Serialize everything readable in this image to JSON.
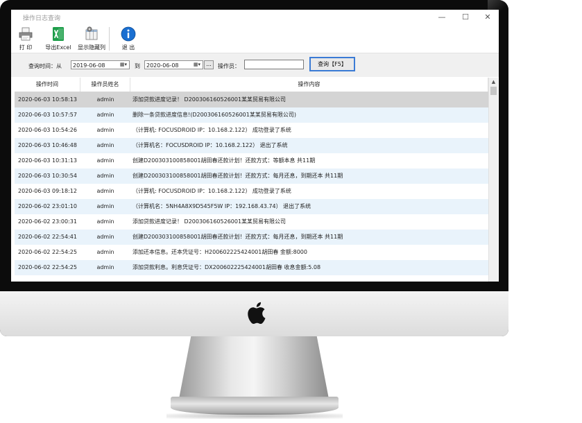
{
  "window": {
    "title": "操作日志查询"
  },
  "window_controls": {
    "minimize": "—",
    "maximize": "☐",
    "close": "✕"
  },
  "toolbar": {
    "print": "打 印",
    "export_excel": "导出Excel",
    "show_hidden_cols": "显示隐藏列",
    "exit": "退 出"
  },
  "search": {
    "time_label": "查询时间：从",
    "from_date": "2019-06-08",
    "to_label": "到",
    "to_date": "2020-06-08",
    "ellipsis": "...",
    "operator_label": "操作员：",
    "operator_value": "",
    "query_button": "查询【F5】"
  },
  "table": {
    "headers": [
      "操作时间",
      "操作员姓名",
      "操作内容"
    ],
    "rows": [
      {
        "time": "2020-06-03 10:58:13",
        "name": "admin",
        "content": "添加贷款进度记录！ D200306160526001某某贸易有限公司"
      },
      {
        "time": "2020-06-03 10:57:57",
        "name": "admin",
        "content": "删除一条贷款进度信息!(D200306160526001某某贸易有限公司)"
      },
      {
        "time": "2020-06-03 10:54:26",
        "name": "admin",
        "content": "（计算机: FOCUSDROID IP：10.168.2.122） 成功登录了系统"
      },
      {
        "time": "2020-06-03 10:46:48",
        "name": "admin",
        "content": "（计算机名：FOCUSDROID IP：10.168.2.122） 退出了系统"
      },
      {
        "time": "2020-06-03 10:31:13",
        "name": "admin",
        "content": "创建D200303100858001胡田春还款计划！还款方式：等额本息 共11期"
      },
      {
        "time": "2020-06-03 10:30:54",
        "name": "admin",
        "content": "创建D200303100858001胡田春还款计划！还款方式：每月还息，到期还本 共11期"
      },
      {
        "time": "2020-06-03 09:18:12",
        "name": "admin",
        "content": "（计算机: FOCUSDROID IP：10.168.2.122） 成功登录了系统"
      },
      {
        "time": "2020-06-02 23:01:10",
        "name": "admin",
        "content": "（计算机名：5NH4A8X9D545F5W IP：192.168.43.74） 退出了系统"
      },
      {
        "time": "2020-06-02 23:00:31",
        "name": "admin",
        "content": "添加贷款进度记录！ D200306160526001某某贸易有限公司"
      },
      {
        "time": "2020-06-02 22:54:41",
        "name": "admin",
        "content": "创建D200303100858001胡田春还款计划！还款方式：每月还息，到期还本 共11期"
      },
      {
        "time": "2020-06-02 22:54:25",
        "name": "admin",
        "content": "添加还本信息。还本凭证号：H200602225424001胡田春 金额:8000"
      },
      {
        "time": "2020-06-02 22:54:25",
        "name": "admin",
        "content": "添加贷款利息。利息凭证号：DX200602225424001胡田春 收息金额:5.08"
      }
    ]
  },
  "icons": {
    "print": "printer-icon",
    "excel": "excel-icon",
    "columns": "columns-icon",
    "exit": "info-icon",
    "brand": "apple-logo"
  },
  "colors": {
    "alt_row": "#e9f3fb",
    "selected_row": "#d4d4d4",
    "focus_border": "#3a7bd5",
    "excel_green": "#1e9e4a",
    "exit_blue": "#1a6fd1"
  }
}
